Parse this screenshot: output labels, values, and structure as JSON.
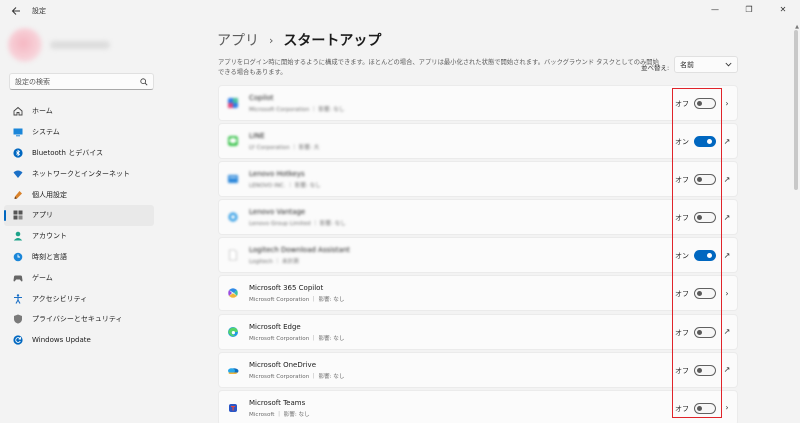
{
  "window": {
    "title": "設定",
    "minimize": "—",
    "restore": "❐",
    "close": "✕"
  },
  "sidebar": {
    "search_placeholder": "設定の検索",
    "items": [
      {
        "label": "ホーム",
        "icon": "home-icon"
      },
      {
        "label": "システム",
        "icon": "system-icon"
      },
      {
        "label": "Bluetooth とデバイス",
        "icon": "bluetooth-icon"
      },
      {
        "label": "ネットワークとインターネット",
        "icon": "network-icon"
      },
      {
        "label": "個人用設定",
        "icon": "personalization-icon"
      },
      {
        "label": "アプリ",
        "icon": "apps-icon",
        "active": true
      },
      {
        "label": "アカウント",
        "icon": "account-icon"
      },
      {
        "label": "時刻と言語",
        "icon": "time-language-icon"
      },
      {
        "label": "ゲーム",
        "icon": "gaming-icon"
      },
      {
        "label": "アクセシビリティ",
        "icon": "accessibility-icon"
      },
      {
        "label": "プライバシーとセキュリティ",
        "icon": "privacy-icon"
      },
      {
        "label": "Windows Update",
        "icon": "windows-update-icon"
      }
    ]
  },
  "header": {
    "breadcrumb_parent": "アプリ",
    "breadcrumb_sep": "›",
    "breadcrumb_current": "スタートアップ",
    "description": "アプリをログイン時に開始するように構成できます。ほとんどの場合、アプリは最小化された状態で開始されます。バックグラウンド タスクとしてのみ開始できる場合もあります。",
    "sort_label": "並べ替え:",
    "sort_value": "名前"
  },
  "apps": [
    {
      "name": "Copilot",
      "publisher": "Microsoft Corporation",
      "impact": "影響: なし",
      "state": "オフ",
      "on": false,
      "action": "›",
      "blurred": true
    },
    {
      "name": "LINE",
      "publisher": "LY Corporation",
      "impact": "影響: 大",
      "state": "オン",
      "on": true,
      "action": "↗",
      "blurred": true
    },
    {
      "name": "Lenovo Hotkeys",
      "publisher": "LENOVO INC.",
      "impact": "影響: なし",
      "state": "オフ",
      "on": false,
      "action": "↗",
      "blurred": true
    },
    {
      "name": "Lenovo Vantage",
      "publisher": "Lenovo Group Limited",
      "impact": "影響: なし",
      "state": "オフ",
      "on": false,
      "action": "↗",
      "blurred": true
    },
    {
      "name": "Logitech Download Assistant",
      "publisher": "Logitech",
      "impact": "未計測",
      "state": "オン",
      "on": true,
      "action": "↗",
      "blurred": true
    },
    {
      "name": "Microsoft 365 Copilot",
      "publisher": "Microsoft Corporation",
      "impact": "影響: なし",
      "state": "オフ",
      "on": false,
      "action": "›",
      "blurred": false
    },
    {
      "name": "Microsoft Edge",
      "publisher": "Microsoft Corporation",
      "impact": "影響: なし",
      "state": "オフ",
      "on": false,
      "action": "↗",
      "blurred": false
    },
    {
      "name": "Microsoft OneDrive",
      "publisher": "Microsoft Corporation",
      "impact": "影響: なし",
      "state": "オフ",
      "on": false,
      "action": "↗",
      "blurred": false
    },
    {
      "name": "Microsoft Teams",
      "publisher": "Microsoft",
      "impact": "影響: なし",
      "state": "オフ",
      "on": false,
      "action": "›",
      "blurred": false
    }
  ],
  "colors": {
    "accent": "#0067c0",
    "highlight_box": "#e0242a"
  }
}
